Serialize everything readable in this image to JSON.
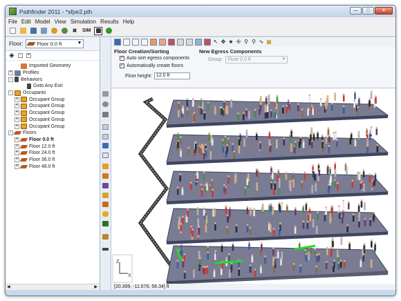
{
  "window": {
    "title": "Pathfinder 2011 - *sfpe2.pth"
  },
  "menu": [
    "File",
    "Edit",
    "Model",
    "View",
    "Simulation",
    "Results",
    "Help"
  ],
  "toolbar": {
    "sim_label": "SIM"
  },
  "left_panel": {
    "floor_label": "Floor:",
    "floor_value": "Floor 0.0 ft"
  },
  "tree": [
    {
      "label": "Imported Geometry",
      "indent": 1,
      "icon": "geometry",
      "exp": ""
    },
    {
      "label": "Profiles",
      "indent": 0,
      "icon": "profiles",
      "exp": "+"
    },
    {
      "label": "Behaviors",
      "indent": 0,
      "icon": "behaviors",
      "exp": "-"
    },
    {
      "label": "Goto Any Exit",
      "indent": 2,
      "icon": "behaviors",
      "exp": ""
    },
    {
      "label": "Occupants",
      "indent": 0,
      "icon": "people",
      "exp": "-"
    },
    {
      "label": "Occupant Group",
      "indent": 1,
      "icon": "people",
      "exp": "+"
    },
    {
      "label": "Occupant Group",
      "indent": 1,
      "icon": "people",
      "exp": "+"
    },
    {
      "label": "Occupant Group",
      "indent": 1,
      "icon": "people",
      "exp": "+"
    },
    {
      "label": "Occupant Group",
      "indent": 1,
      "icon": "people",
      "exp": "+"
    },
    {
      "label": "Occupant Group",
      "indent": 1,
      "icon": "people",
      "exp": "+"
    },
    {
      "label": "Floors",
      "indent": 0,
      "icon": "floor",
      "exp": "-"
    },
    {
      "label": "Floor 0.0 ft",
      "indent": 1,
      "icon": "floor",
      "exp": "+",
      "bold": true
    },
    {
      "label": "Floor 12.0 ft",
      "indent": 1,
      "icon": "floor",
      "exp": "+"
    },
    {
      "label": "Floor 24.0 ft",
      "indent": 1,
      "icon": "floor",
      "exp": "+"
    },
    {
      "label": "Floor 36.0 ft",
      "indent": 1,
      "icon": "floor",
      "exp": "+"
    },
    {
      "label": "Floor 48.0 ft",
      "indent": 1,
      "icon": "floor",
      "exp": "+"
    }
  ],
  "props": {
    "floor_creation_title": "Floor Creation/Sorting",
    "auto_sort_label": "Auto sort egress components",
    "auto_sort_checked": true,
    "auto_create_label": "Automatically create floors",
    "auto_create_checked": true,
    "floor_height_label": "Floor height:",
    "floor_height_value": "12.0 ft",
    "new_egress_title": "New Egress Components",
    "group_label": "Group:",
    "group_value": "Floor 0.0 ft"
  },
  "viewport": {
    "axis_z": "Z",
    "axis_x": "X"
  },
  "status": {
    "coords": "[20.399, -11.676, 56.34] ft"
  },
  "colors": {
    "accent": "#3b6bb5",
    "exit_green": "#22dd22",
    "floor_top": "#3e4560"
  }
}
